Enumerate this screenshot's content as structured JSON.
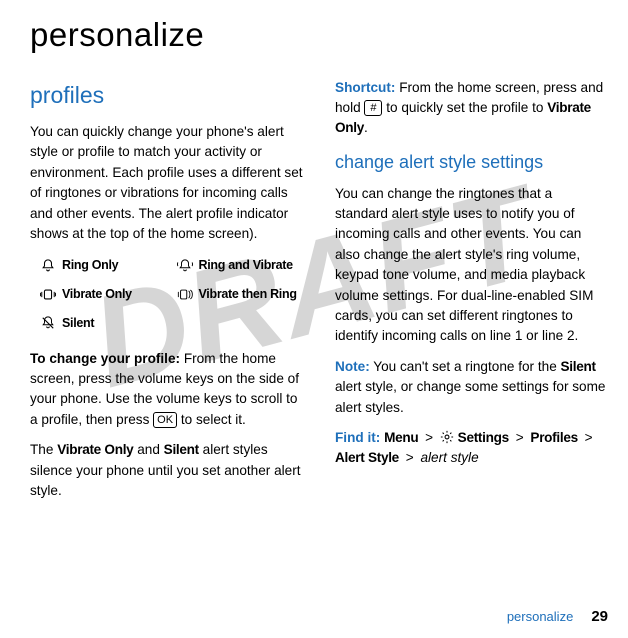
{
  "watermark": "DRAFT",
  "title": "personalize",
  "left": {
    "section_title": "profiles",
    "intro": "You can quickly change your phone's alert style or profile to match your activity or environment. Each profile uses a different set of ringtones or vibrations for incoming calls and other events. The alert profile indicator shows at the top of the home screen).",
    "modes": {
      "ring_only": "Ring Only",
      "ring_vibrate": "Ring and Vibrate",
      "vibrate_only": "Vibrate Only",
      "vibrate_then_ring": "Vibrate then Ring",
      "silent": "Silent"
    },
    "change_profile_bold": "To change your profile:",
    "change_profile_rest": " From the home screen, press the volume keys on the side of your phone. Use the volume keys to scroll to a profile, then press ",
    "ok_key": "OK",
    "change_profile_tail": " to select it.",
    "final_a": "The ",
    "vibrate_only_label": "Vibrate Only",
    "final_b": " and ",
    "silent_label": "Silent",
    "final_c": " alert styles silence your phone until you set another alert style."
  },
  "right": {
    "shortcut_label": "Shortcut:",
    "shortcut_a": " From the home screen, press and hold ",
    "hash_key": "#",
    "shortcut_b": " to quickly set the profile to ",
    "shortcut_profile": "Vibrate Only",
    "shortcut_c": ".",
    "sub_title": "change alert style settings",
    "body1": "You can change the ringtones that a standard alert style uses to notify you of incoming calls and other events. You can also change the alert style's ring volume, keypad tone volume, and media playback volume settings. For dual-line-enabled SIM cards, you can set different ringtones to identify incoming calls on line 1 or line 2.",
    "note_label": "Note:",
    "note_a": " You can't set a ringtone for the ",
    "note_silent": "Silent",
    "note_b": " alert style, or change some settings for some alert styles.",
    "find_label": "Find it:",
    "path": {
      "menu": "Menu",
      "settings": "Settings",
      "profiles": "Profiles",
      "alert_style": "Alert Style",
      "italic": "alert style",
      "sep": ">"
    }
  },
  "footer": {
    "name": "personalize",
    "page": "29"
  }
}
